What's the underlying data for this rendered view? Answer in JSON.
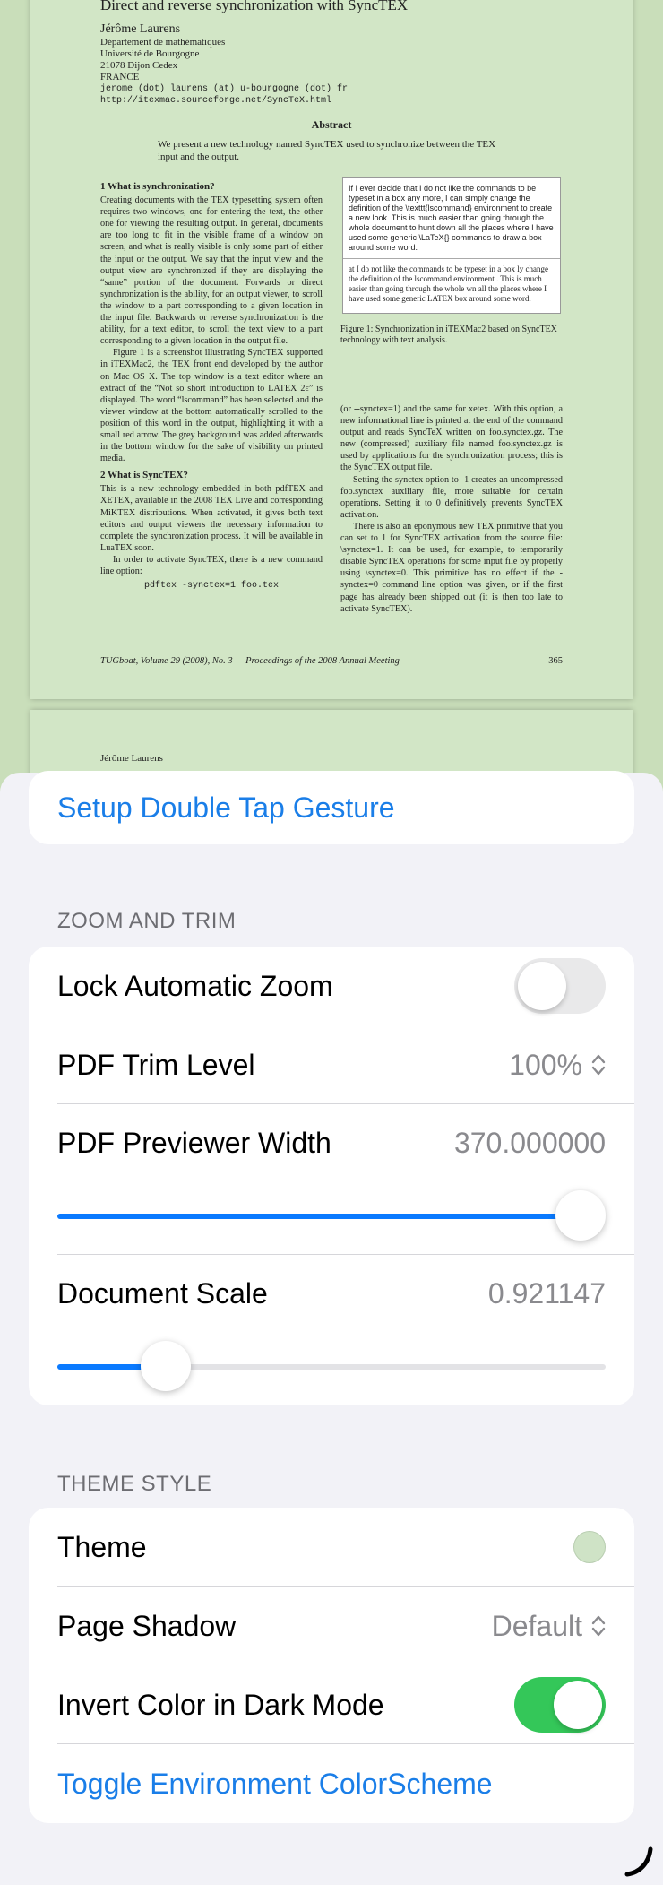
{
  "pdf": {
    "title": "Direct and reverse synchronization with SyncTEX",
    "author_name": "Jérôme Laurens",
    "author_lines": [
      "Département de mathématiques",
      "Université de Bourgogne",
      "21078 Dijon Cedex",
      "FRANCE"
    ],
    "email": "jerome (dot) laurens (at) u-bourgogne (dot) fr",
    "url": "http://itexmac.sourceforge.net/SyncTeX.html",
    "abstract_heading": "Abstract",
    "abstract_text": "We present a new technology named SyncTEX used to synchronize between the TEX input and the output.",
    "section1_title": "1   What is synchronization?",
    "section1_text": "Creating documents with the TEX typesetting system often requires two windows, one for entering the text, the other one for viewing the resulting output. In general, documents are too long to fit in the visible frame of a window on screen, and what is really visible is only some part of either the input or the output. We say that the input view and the output view are synchronized if they are displaying the “same” portion of the document. Forwards or direct synchronization is the ability, for an output viewer, to scroll the window to a part corresponding to a given location in the input file. Backwards or reverse synchronization is the ability, for a text editor, to scroll the text view to a part corresponding to a given location in the output file.",
    "section1_text2": "Figure 1 is a screenshot illustrating SyncTEX supported in iTEXMac2, the TEX front end developed by the author on Mac OS X. The top window is a text editor where an extract of the “Not so short introduction to LATEX 2ε” is displayed. The word “lscommand” has been selected and the viewer window at the bottom automatically scrolled to the position of this word in the output, highlighting it with a small red arrow. The grey background was added afterwards in the bottom window for the sake of visibility on printed media.",
    "section2_title": "2   What is SyncTEX?",
    "section2_text": "This is a new technology embedded in both pdfTEX and XETEX, available in the 2008 TEX Live and corresponding MiKTEX distributions. When activated, it gives both text editors and output viewers the necessary information to complete the synchronization process. It will be available in LuaTEX soon.",
    "section2_text2": "In order to activate SyncTEX, there is a new command line option:",
    "command": "pdftex -synctex=1 foo.tex",
    "figure_text1": "If I ever decide that I do not like the commands to be typeset in a box any more, I can simply change the definition of the \\texttt{lscommand} environment to create a new look. This is much easier than going through the whole document to hunt down all the places where I have used some generic \\LaTeX{} commands to draw a box around some word.",
    "figure_text2": "at I do not like the commands to be typeset in a box ly change the definition of the lscommand environment . This is much easier than going through the whole wn all the places where I have used some generic LATEX box around some word.",
    "figure_caption": "Figure 1: Synchronization in iTEXMac2 based on SyncTEX technology with text analysis.",
    "right_col_text1": "(or --synctex=1) and the same for xetex. With this option, a new informational line is printed at the end of the command output and reads SyncTeX written on foo.synctex.gz. The new (compressed) auxiliary file named foo.synctex.gz is used by applications for the synchronization process; this is the SyncTEX output file.",
    "right_col_text2": "Setting the synctex option to -1 creates an uncompressed foo.synctex auxiliary file, more suitable for certain operations. Setting it to 0 definitively prevents SyncTEX activation.",
    "right_col_text3": "There is also an eponymous new TEX primitive that you can set to 1 for SyncTEX activation from the source file: \\synctex=1. It can be used, for example, to temporarily disable SyncTEX operations for some input file by properly using \\synctex=0. This primitive has no effect if the -synctex=0 command line option was given, or if the first page has already been shipped out (it is then too late to activate SyncTEX).",
    "footer_left": "TUGboat, Volume 29 (2008), No. 3 — Proceedings of the 2008 Annual Meeting",
    "footer_right": "365",
    "page2_author": "Jérôme Laurens"
  },
  "settings": {
    "gesture_link": "Setup Double Tap Gesture",
    "zoom_header": "ZOOM AND TRIM",
    "lock_zoom_label": "Lock Automatic Zoom",
    "lock_zoom_on": false,
    "trim_label": "PDF Trim Level",
    "trim_value": "100%",
    "previewer_label": "PDF Previewer Width",
    "previewer_value": "370.000000",
    "previewer_fraction": 1.0,
    "scale_label": "Document Scale",
    "scale_value": "0.921147",
    "scale_fraction": 0.198,
    "theme_header": "THEME STYLE",
    "theme_label": "Theme",
    "theme_color": "#cfe3c6",
    "shadow_label": "Page Shadow",
    "shadow_value": "Default",
    "invert_label": "Invert Color in Dark Mode",
    "invert_on": true,
    "toggle_env_link": "Toggle Environment ColorScheme"
  },
  "colors": {
    "accent": "#1a7ee8",
    "slider_fill": "#0a7aff",
    "toggle_on": "#34c759"
  },
  "icons": {
    "corner": "resize-handle-icon",
    "chevron": "chevron-up-down-icon"
  }
}
